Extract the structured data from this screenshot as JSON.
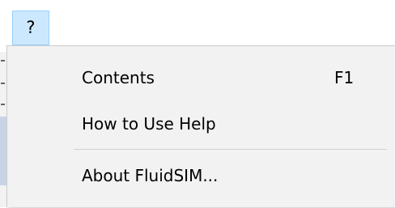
{
  "menubar": {
    "help_label": "?"
  },
  "help_menu": {
    "items": [
      {
        "label": "Contents",
        "shortcut": "F1"
      },
      {
        "label": "How to Use Help",
        "shortcut": ""
      },
      {
        "label": "About FluidSIM...",
        "shortcut": ""
      }
    ]
  },
  "colors": {
    "menu_background": "#f2f2f2",
    "active_menubar_highlight": "#cce8ff",
    "separator": "#cfcfcf"
  }
}
